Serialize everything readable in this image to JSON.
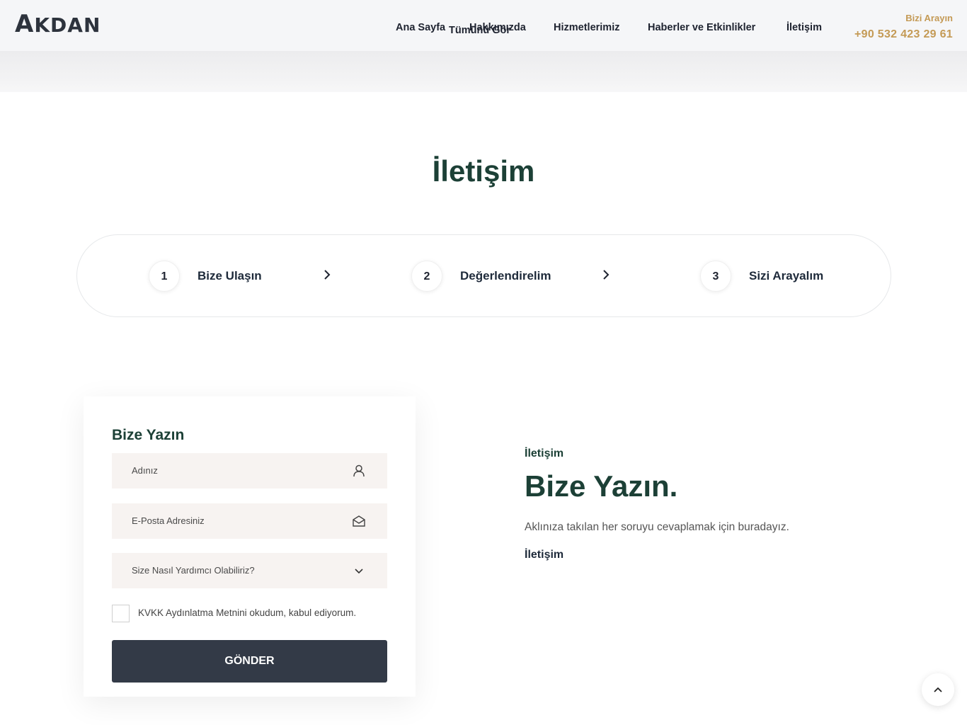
{
  "header": {
    "logo": {
      "big": "A",
      "rest": "KDAN"
    },
    "nav": {
      "home": "Ana Sayfa",
      "about": "Hakkımızda",
      "about_overlay": "Tümünü Gör",
      "services": "Hizmetlerimiz",
      "news": "Haberler ve Etkinlikler",
      "contact": "İletişim"
    },
    "call": {
      "label": "Bizi Arayın",
      "phone": "+90 532 423 29 61"
    }
  },
  "page_title": "İletişim",
  "steps": [
    {
      "number": "1",
      "label": "Bize Ulaşın"
    },
    {
      "number": "2",
      "label": "Değerlendirelim"
    },
    {
      "number": "3",
      "label": "Sizi Arayalım"
    }
  ],
  "form": {
    "title": "Bize Yazın",
    "name_placeholder": "Adınız",
    "email_placeholder": "E-Posta Adresiniz",
    "topic_placeholder": "Size Nasıl Yardımcı Olabiliriz?",
    "consent": "KVKK Aydınlatma Metnini okudum, kabul ediyorum.",
    "submit": "GÖNDER"
  },
  "side": {
    "eyebrow": "İletişim",
    "title": "Bize Yazın.",
    "text": "Aklınıza takılan her soruyu cevaplamak için buradayız.",
    "link": "İletişim"
  },
  "icons": {
    "name_field": "user-icon",
    "email_field": "envelope-open-icon",
    "topic_field": "chevron-down-icon",
    "step_arrow": "chevron-right-icon",
    "to_top": "chevron-up-icon"
  },
  "colors": {
    "brand_green": "#1c4036",
    "accent_gold": "#c49a55",
    "button_dark": "#333a47",
    "field_bg": "#f7f3f1"
  }
}
